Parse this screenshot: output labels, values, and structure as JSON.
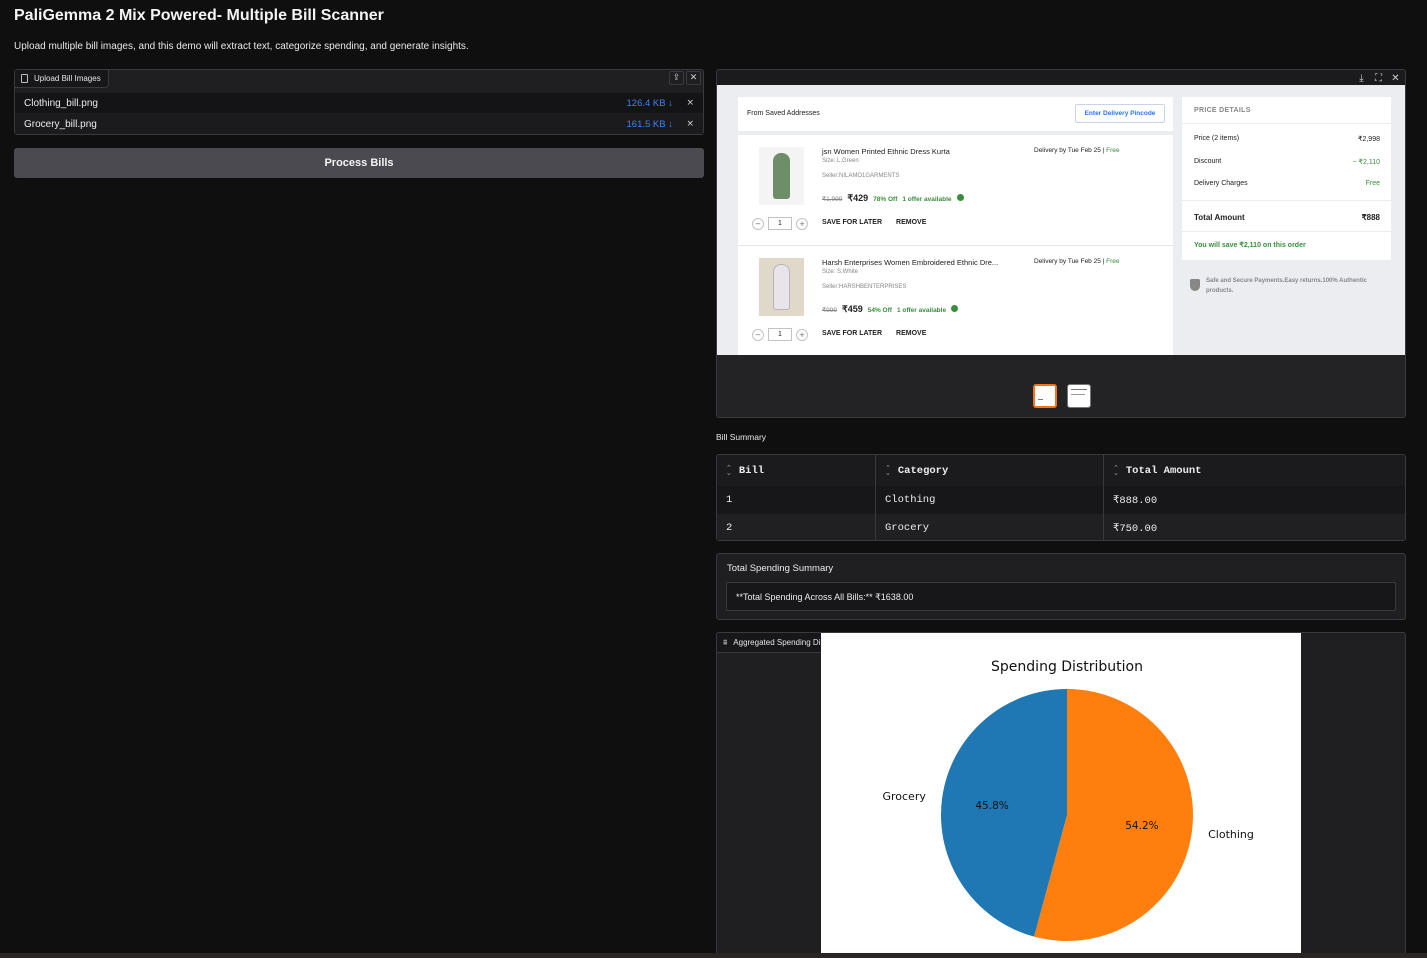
{
  "app": {
    "title": "PaliGemma 2 Mix Powered- Multiple Bill Scanner",
    "description": "Upload multiple bill images, and this demo will extract text, categorize spending, and generate insights."
  },
  "upload": {
    "label": "Upload Bill Images",
    "files": [
      {
        "name": "Clothing_bill.png",
        "size": "126.4 KB ↓"
      },
      {
        "name": "Grocery_bill.png",
        "size": "161.5 KB ↓"
      }
    ],
    "remove_symbol": "×",
    "upload_icon": "upload-icon",
    "clear_icon": "close-icon"
  },
  "process_button": "Process Bills",
  "gallery": {
    "tools": [
      "download-icon",
      "fullscreen-icon",
      "close-icon"
    ],
    "bill": {
      "address_text": "From Saved Addresses",
      "pincode_button": "Enter Delivery Pincode",
      "items": [
        {
          "title": "jsn Women Printed Ethnic Dress Kurta",
          "size": "Size: L,Green",
          "seller": "Seller:NILAMO1GARMENTS",
          "old_price": "₹1,999",
          "price": "₹429",
          "off": "78% Off",
          "offer": "1 offer available",
          "delivery": "Delivery by Tue Feb 25 | ",
          "delivery_free": "Free",
          "qty": "1",
          "save_later": "SAVE FOR LATER",
          "remove": "REMOVE"
        },
        {
          "title": "Harsh Enterprises Women Embroidered Ethnic Dre...",
          "size": "Size: S,White",
          "seller": "Seller:HARSHBENTERPRISES",
          "old_price": "₹999",
          "price": "₹459",
          "off": "54% Off",
          "offer": "1 offer available",
          "delivery": "Delivery by Tue Feb 25 | ",
          "delivery_free": "Free",
          "qty": "1",
          "save_later": "SAVE FOR LATER",
          "remove": "REMOVE"
        }
      ],
      "price_details": {
        "title": "PRICE DETAILS",
        "rows": [
          {
            "label": "Price (2 items)",
            "value": "₹2,998"
          },
          {
            "label": "Discount",
            "value": "− ₹2,110"
          },
          {
            "label": "Delivery Charges",
            "value": "Free"
          }
        ],
        "total_label": "Total Amount",
        "total_value": "₹888",
        "savings": "You will save ₹2,110 on this order"
      },
      "secure_text": "Safe and Secure Payments.Easy returns.100% Authentic products."
    }
  },
  "summary": {
    "label": "Bill Summary",
    "columns": [
      "Bill",
      "Category",
      "Total Amount"
    ],
    "rows": [
      [
        "1",
        "Clothing",
        "₹888.00"
      ],
      [
        "2",
        "Grocery",
        "₹750.00"
      ]
    ]
  },
  "total": {
    "label": "Total Spending Summary",
    "text": "**Total Spending Across All Bills:** ₹1638.00"
  },
  "plot": {
    "label": "Aggregated Spending Distribution"
  },
  "chart_data": {
    "type": "pie",
    "title": "Spending Distribution",
    "categories": [
      "Clothing",
      "Grocery"
    ],
    "values": [
      888,
      750
    ],
    "percent_labels": [
      "54.2%",
      "45.8%"
    ],
    "colors": [
      "#ff7f0e",
      "#1f77b4"
    ],
    "start_angle_deg": 90,
    "direction": "clockwise"
  }
}
